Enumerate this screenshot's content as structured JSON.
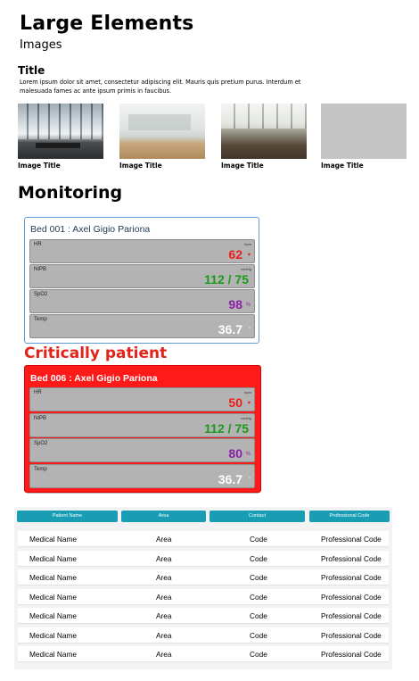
{
  "heading": "Large Elements",
  "subheading": "Images",
  "title": "Title",
  "lorem": "Lorem ipsum dolor sit amet, consectetur adipiscing elit. Mauris quis pretium purus. Interdum et malesuada fames ac ante ipsum primis in faucibus.",
  "images": [
    {
      "caption": "Image Title"
    },
    {
      "caption": "Image Title"
    },
    {
      "caption": "Image Title"
    },
    {
      "caption": "Image Title"
    }
  ],
  "monitoring_heading": "Monitoring",
  "monitor": {
    "title": "Bed 001 : Axel Gigio Pariona",
    "vitals": [
      {
        "label": "HR",
        "unit": "bpm",
        "value": "62",
        "symbol": "♥",
        "color": "#ee1c1c"
      },
      {
        "label": "NIPB",
        "unit": "mmHg",
        "value": "112 / 75",
        "symbol": "",
        "color": "#1a9a1a"
      },
      {
        "label": "SpO2",
        "unit": "",
        "value": "98",
        "symbol": "%",
        "color": "#8b1fa5"
      },
      {
        "label": "Temp",
        "unit": "",
        "value": "36.7",
        "symbol": "°",
        "color": "#ffffff"
      }
    ]
  },
  "critical_label": "Critically patient",
  "critical": {
    "title": "Bed 006 : Axel Gigio Pariona",
    "vitals": [
      {
        "label": "HR",
        "unit": "bpm",
        "value": "50",
        "symbol": "♥",
        "color": "#ee1c1c"
      },
      {
        "label": "NIPB",
        "unit": "mmHg",
        "value": "112 / 75",
        "symbol": "",
        "color": "#1a9a1a"
      },
      {
        "label": "SpO2",
        "unit": "",
        "value": "80",
        "symbol": "%",
        "color": "#8b1fa5"
      },
      {
        "label": "Temp",
        "unit": "",
        "value": "36.7",
        "symbol": "°",
        "color": "#ffffff"
      }
    ]
  },
  "table": {
    "headers": [
      "Patient Name",
      "Area",
      "Contact",
      "Professional Code"
    ],
    "rows": [
      [
        "Medical Name",
        "Area",
        "Code",
        "Professional Code"
      ],
      [
        "Medical Name",
        "Area",
        "Code",
        "Professional Code"
      ],
      [
        "Medical Name",
        "Area",
        "Code",
        "Professional Code"
      ],
      [
        "Medical Name",
        "Area",
        "Code",
        "Professional Code"
      ],
      [
        "Medical Name",
        "Area",
        "Code",
        "Professional Code"
      ],
      [
        "Medical Name",
        "Area",
        "Code",
        "Professional Code"
      ],
      [
        "Medical Name",
        "Area",
        "Code",
        "Professional Code"
      ]
    ]
  }
}
